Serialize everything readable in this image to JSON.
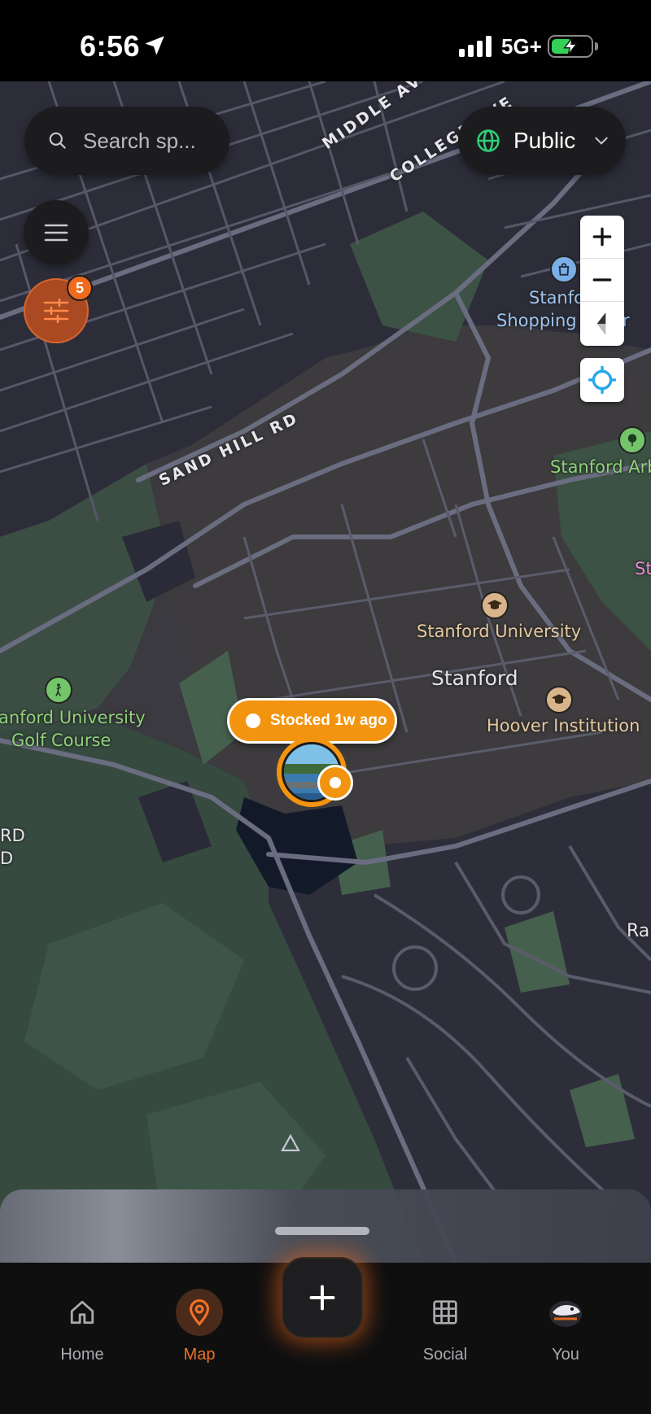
{
  "status_bar": {
    "time": "6:56",
    "network": "5G+",
    "battery_level": 0.55,
    "battery_color": "#33d158"
  },
  "search": {
    "placeholder": "Search sp..."
  },
  "visibility": {
    "label": "Public",
    "icon": "globe-icon"
  },
  "filter": {
    "badge_count": "5",
    "accent": "#f26a1b"
  },
  "map": {
    "roads": [
      "MIDDLE AVE",
      "COLLEGE AVE",
      "SAND HILL RD"
    ],
    "pois": [
      {
        "name": "Stanford University",
        "type": "education"
      },
      {
        "name": "Hoover Institution",
        "type": "education"
      },
      {
        "name_line1": "anford University",
        "name_line2": "Golf Course",
        "type": "golf"
      },
      {
        "name_line1": "Stanfo",
        "name_line2": "Shopping C",
        "name_line2b": "er",
        "type": "shopping"
      },
      {
        "name": "Stanford Arb",
        "type": "park"
      },
      {
        "name": "St",
        "type": "other"
      }
    ],
    "places": [
      "Stanford",
      "Ra"
    ],
    "edge_labels": [
      "RD",
      "D"
    ],
    "spot": {
      "status": "Stocked 1w ago",
      "color": "#f2940f"
    }
  },
  "tabs": [
    {
      "label": "Home",
      "icon": "home-icon",
      "active": false
    },
    {
      "label": "Map",
      "icon": "map-pin-icon",
      "active": true
    },
    {
      "label": "Social",
      "icon": "grid-icon",
      "active": false
    },
    {
      "label": "You",
      "icon": "avatar-icon",
      "active": false
    }
  ]
}
